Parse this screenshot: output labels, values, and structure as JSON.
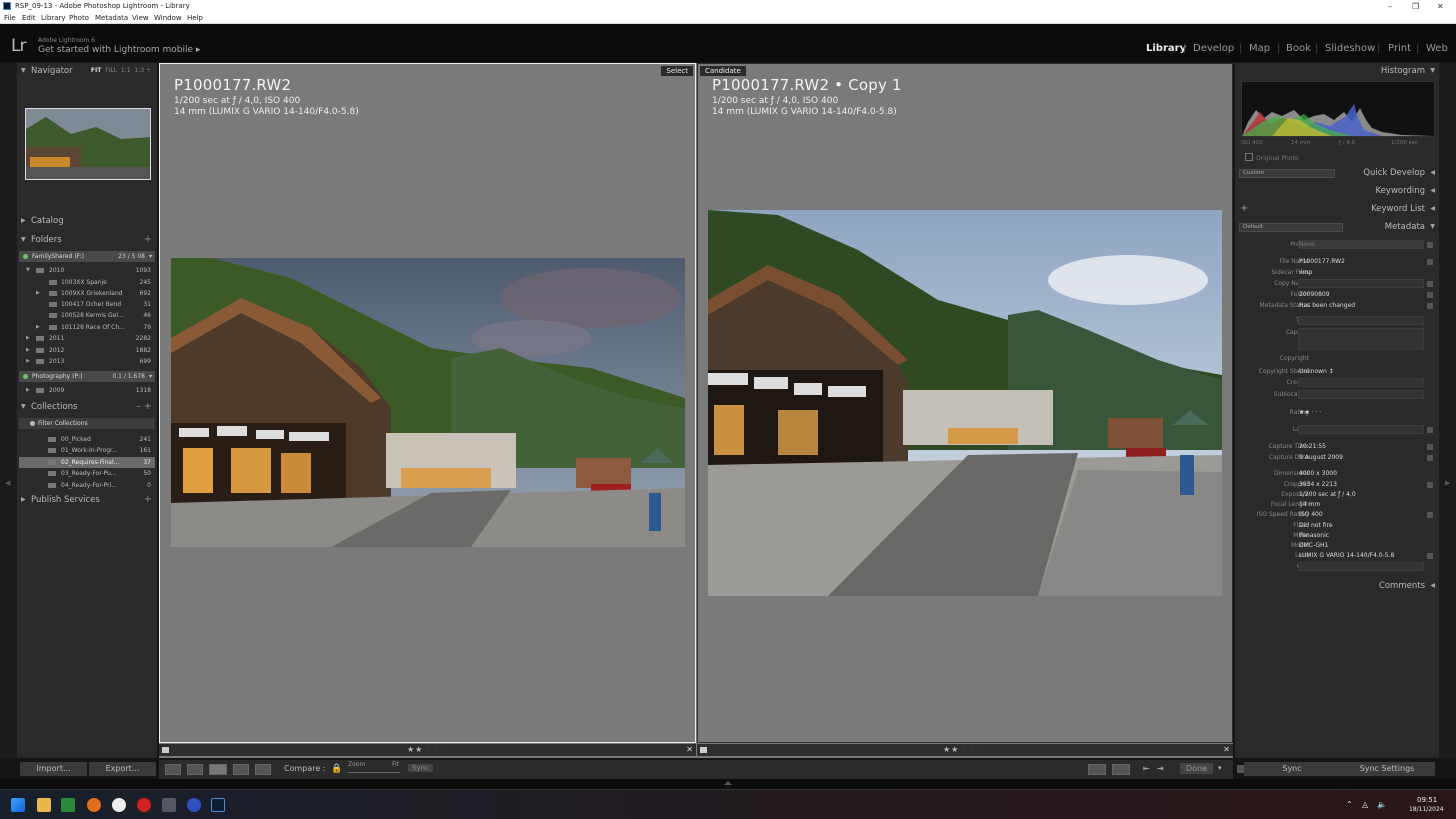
{
  "window": {
    "title": "RSP_09-13 - Adobe Photoshop Lightroom - Library"
  },
  "menu": [
    "File",
    "Edit",
    "Library",
    "Photo",
    "Metadata",
    "View",
    "Window",
    "Help"
  ],
  "identity": {
    "logo": "Lr",
    "product": "Adobe Lightroom 6",
    "tagline": "Get started with Lightroom mobile ▸"
  },
  "modules": {
    "items": [
      "Library",
      "Develop",
      "Map",
      "Book",
      "Slideshow",
      "Print",
      "Web"
    ],
    "active": "Library"
  },
  "left": {
    "navigator": {
      "title": "Navigator",
      "fit": "FIT",
      "fill": "FILL",
      "r1": "1:1",
      "r2": "1:3 ÷"
    },
    "catalog": "Catalog",
    "folders": {
      "title": "Folders",
      "volume1": {
        "name": "FamilyShared (F:)",
        "count": "23 / 5 08"
      },
      "rows": [
        {
          "label": "2010",
          "count": "1093"
        },
        {
          "label": "1003XX Spanje",
          "count": "245"
        },
        {
          "label": "1009XX Griekenland",
          "count": "692"
        },
        {
          "label": "100417 Ocher Bend",
          "count": "31"
        },
        {
          "label": "100528 Kermis Gel...",
          "count": "46"
        },
        {
          "label": "101128 Race Of Ch...",
          "count": "79"
        },
        {
          "label": "2011",
          "count": "2282"
        },
        {
          "label": "2012",
          "count": "1882"
        },
        {
          "label": "2013",
          "count": "699"
        }
      ],
      "volume2": {
        "name": "Photography (P:)",
        "count": "0.1 / 1.678"
      },
      "row_2009": {
        "label": "2009",
        "count": "1318"
      }
    },
    "collections": {
      "title": "Collections",
      "filter": "Filter Collections",
      "rows": [
        {
          "label": "00_Picked",
          "count": "241"
        },
        {
          "label": "01_Work-In-Progr...",
          "count": "161"
        },
        {
          "label": "02_Requires-Final...",
          "count": "37"
        },
        {
          "label": "03_Ready-For-Pu...",
          "count": "50"
        },
        {
          "label": "04_Ready-For-Pri...",
          "count": "0"
        }
      ]
    },
    "publish": "Publish Services",
    "import_btn": "Import...",
    "export_btn": "Export..."
  },
  "compare": {
    "select": {
      "tag": "Select",
      "title": "P1000177.RW2",
      "line1": "1/200 sec at ƒ / 4,0, ISO 400",
      "line2": "14 mm (LUMIX G VARIO 14-140/F4.0-5.8)",
      "rating": 2
    },
    "candidate": {
      "tag": "Candidate",
      "title": "P1000177.RW2 • Copy 1",
      "line1": "1/200 sec at ƒ / 4,0, ISO 400",
      "line2": "14 mm (LUMIX G VARIO 14-140/F4.0-5.8)",
      "rating": 2
    }
  },
  "toolbar": {
    "compare_label": "Compare :",
    "zoom": "Zoom",
    "fit": "Fit",
    "sync": "Sync",
    "done": "Done"
  },
  "right": {
    "histogram": {
      "title": "Histogram",
      "iso": "ISO 400",
      "focal": "14 mm",
      "aperture": "ƒ / 4,0",
      "shutter": "1/200 sec",
      "original": "Original Photo"
    },
    "quick_develop": {
      "title": "Quick Develop",
      "preset": "Custom"
    },
    "keywording": "Keywording",
    "keyword_list": "Keyword List",
    "metadata": {
      "title": "Metadata",
      "preset_sel": "Default",
      "fields": [
        {
          "label": "Preset",
          "value": "None"
        },
        {
          "label": "File Name",
          "value": "P1000177.RW2"
        },
        {
          "label": "Sidecar Files",
          "value": "xmp"
        },
        {
          "label": "Copy Name",
          "value": ""
        },
        {
          "label": "Folder",
          "value": "20090809"
        },
        {
          "label": "Metadata Status",
          "value": "Has been changed"
        },
        {
          "label": "Title",
          "value": ""
        },
        {
          "label": "Caption",
          "value": ""
        },
        {
          "label": "Copyright",
          "value": ""
        },
        {
          "label": "Copyright Status",
          "value": "Unknown ↕"
        },
        {
          "label": "Creator",
          "value": ""
        },
        {
          "label": "Sublocation",
          "value": ""
        },
        {
          "label": "Rating",
          "value": "★★ · · ·"
        },
        {
          "label": "Label",
          "value": ""
        },
        {
          "label": "Capture Time",
          "value": "20:21:55"
        },
        {
          "label": "Capture Date",
          "value": "9 August 2009"
        },
        {
          "label": "Dimensions",
          "value": "4000 x 3000"
        },
        {
          "label": "Cropped",
          "value": "3934 x 2213"
        },
        {
          "label": "Exposure",
          "value": "1/200 sec at ƒ / 4,0"
        },
        {
          "label": "Focal Length",
          "value": "14 mm"
        },
        {
          "label": "ISO Speed Rating",
          "value": "ISO 400"
        },
        {
          "label": "Flash",
          "value": "Did not fire"
        },
        {
          "label": "Make",
          "value": "Panasonic"
        },
        {
          "label": "Model",
          "value": "DMC-GH1"
        },
        {
          "label": "Lens",
          "value": "LUMIX G VARIO 14-140/F4.0-5.8"
        },
        {
          "label": "GPS",
          "value": ""
        }
      ]
    },
    "comments": "Comments",
    "sync_btn": "Sync",
    "sync_settings_btn": "Sync Settings"
  },
  "taskbar": {
    "time": "09:51",
    "date": "18/11/2024"
  }
}
